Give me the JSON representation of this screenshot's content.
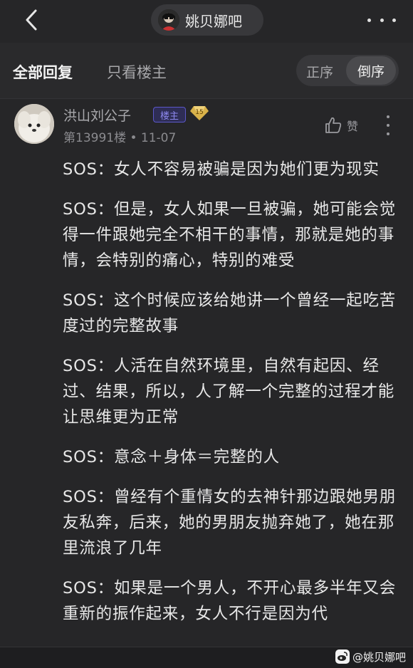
{
  "header": {
    "forum_name": "姚贝娜吧",
    "back_icon": "chevron-left-icon",
    "more_icon": "more-horizontal-icon"
  },
  "filter": {
    "all_replies": "全部回复",
    "author_only": "只看楼主",
    "order_asc": "正序",
    "order_desc": "倒序",
    "selected_order": "倒序"
  },
  "post": {
    "username": "洪山刘公子",
    "op_badge": "楼主",
    "level": "15",
    "floor_meta": "第13991楼 • 11-07",
    "like_label": "赞",
    "paragraphs": [
      "SOS：女人不容易被骗是因为她们更为现实",
      "SOS：但是，女人如果一旦被骗，她可能会觉得一件跟她完全不相干的事情，那就是她的事情，会特别的痛心，特别的难受",
      "SOS：这个时候应该给她讲一个曾经一起吃苦度过的完整故事",
      "SOS：人活在自然环境里，自然有起因、经过、结果，所以，人了解一个完整的过程才能让思维更为正常",
      "SOS：意念＋身体＝完整的人",
      "SOS：曾经有个重情女的去神针那边跟她男朋友私奔，后来，她的男朋友抛弃她了，她在那里流浪了几年",
      "SOS：如果是一个男人，不开心最多半年又会重新的振作起来，女人不行是因为代"
    ]
  },
  "watermark": {
    "text": "@姚贝娜吧",
    "icon": "weibo-icon"
  },
  "colors": {
    "background": "#262628",
    "op_badge": "#8d88ee",
    "level_badge": "#d9b24a"
  }
}
